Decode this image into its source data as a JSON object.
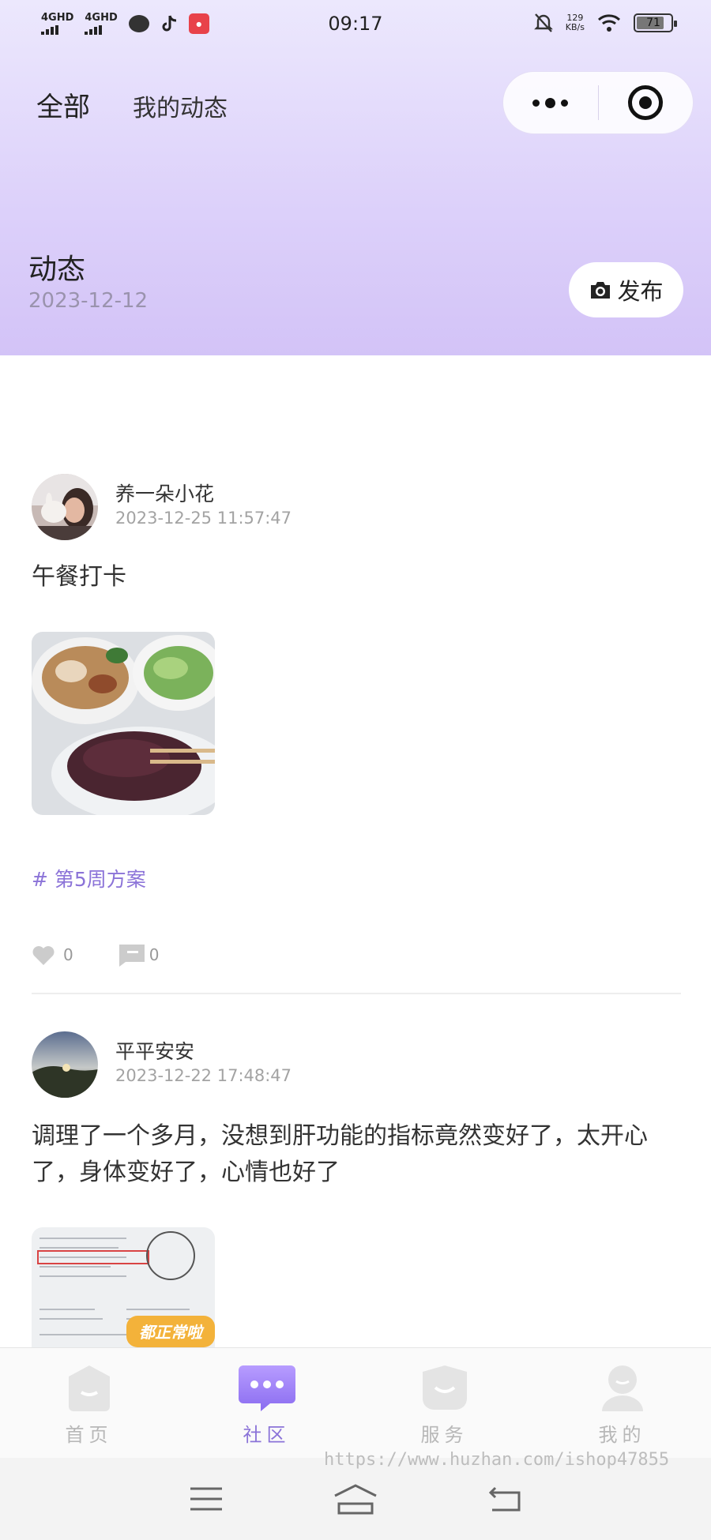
{
  "status_bar": {
    "time": "09:17",
    "network_1": "4GHD",
    "network_2": "4GHD",
    "speed_value": "129",
    "speed_unit": "KB/s",
    "battery": "71"
  },
  "header": {
    "tab_all": "全部",
    "tab_mine": "我的动态"
  },
  "section": {
    "title": "动态",
    "date": "2023-12-12",
    "publish_label": "发布"
  },
  "posts": [
    {
      "user": "养一朵小花",
      "time": "2023-12-25 11:57:47",
      "text": "午餐打卡",
      "topic": "# 第5周方案",
      "likes": "0",
      "comments": "0"
    },
    {
      "user": "平平安安",
      "time": "2023-12-22 17:48:47",
      "text": "调理了一个多月，没想到肝功能的指标竟然变好了，太开心了，身体变好了，心情也好了",
      "image_caption": "都正常啦"
    }
  ],
  "tabbar": {
    "items": [
      {
        "label": "首页",
        "icon": "home-icon"
      },
      {
        "label": "社区",
        "icon": "community-icon"
      },
      {
        "label": "服务",
        "icon": "service-icon"
      },
      {
        "label": "我的",
        "icon": "profile-icon"
      }
    ],
    "active_color": "#8b73d8",
    "inactive_color": "#b8b8b8"
  },
  "watermark": "https://www.huzhan.com/ishop47855"
}
